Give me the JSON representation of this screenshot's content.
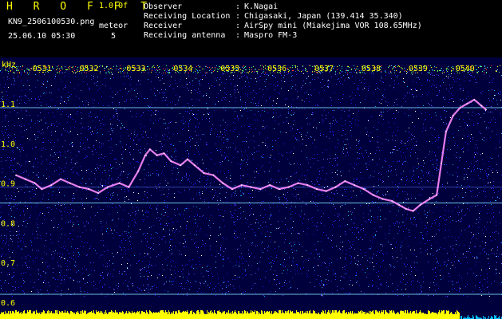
{
  "app": {
    "title": "H R O F F T",
    "version": "1.0.0f",
    "filename": "KN9_2506100530.png",
    "timestamp": "25.06.10 05:30",
    "mode_label": "meteor",
    "mode_value": "5"
  },
  "observation": [
    {
      "key": "Observer",
      "value": "K.Nagai"
    },
    {
      "key": "Receiving Location",
      "value": "Chigasaki, Japan (139.414 35.340)"
    },
    {
      "key": "Receiver",
      "value": "AirSpy mini (Miakejima VOR 108.65MHz)"
    },
    {
      "key": "Receiving antenna",
      "value": "Maspro FM-3"
    }
  ],
  "colors": {
    "background": "#00003c",
    "signal": "#ff88ff",
    "reference_line": "#7fe0ff",
    "power_bar": "#ffff00",
    "labels": "#ffff00"
  },
  "chart_data": {
    "type": "heatmap",
    "ylabel": "kHz",
    "ylim": [
      0.6,
      1.16
    ],
    "yticks": [
      "0.6",
      "0.7",
      "0.8",
      "0.9",
      "1.0",
      "1.1"
    ],
    "xticks": [
      "0531",
      "0532",
      "0533",
      "0534",
      "0535",
      "0536",
      "0537",
      "0538",
      "0539",
      "0540"
    ],
    "xlim_minutes": [
      0.0,
      10.0
    ],
    "reference_lines_khz": [
      1.09,
      0.85,
      0.62
    ],
    "trace": [
      {
        "t": 0.0,
        "f": 0.92
      },
      {
        "t": 0.2,
        "f": 0.91
      },
      {
        "t": 0.4,
        "f": 0.9
      },
      {
        "t": 0.55,
        "f": 0.885
      },
      {
        "t": 0.75,
        "f": 0.895
      },
      {
        "t": 0.95,
        "f": 0.91
      },
      {
        "t": 1.15,
        "f": 0.9
      },
      {
        "t": 1.35,
        "f": 0.89
      },
      {
        "t": 1.55,
        "f": 0.885
      },
      {
        "t": 1.75,
        "f": 0.875
      },
      {
        "t": 1.95,
        "f": 0.89
      },
      {
        "t": 2.2,
        "f": 0.9
      },
      {
        "t": 2.4,
        "f": 0.89
      },
      {
        "t": 2.6,
        "f": 0.93
      },
      {
        "t": 2.75,
        "f": 0.97
      },
      {
        "t": 2.85,
        "f": 0.985
      },
      {
        "t": 3.0,
        "f": 0.97
      },
      {
        "t": 3.15,
        "f": 0.975
      },
      {
        "t": 3.3,
        "f": 0.955
      },
      {
        "t": 3.5,
        "f": 0.945
      },
      {
        "t": 3.65,
        "f": 0.96
      },
      {
        "t": 3.8,
        "f": 0.945
      },
      {
        "t": 4.0,
        "f": 0.925
      },
      {
        "t": 4.2,
        "f": 0.92
      },
      {
        "t": 4.4,
        "f": 0.9
      },
      {
        "t": 4.6,
        "f": 0.885
      },
      {
        "t": 4.8,
        "f": 0.895
      },
      {
        "t": 5.0,
        "f": 0.89
      },
      {
        "t": 5.2,
        "f": 0.885
      },
      {
        "t": 5.4,
        "f": 0.895
      },
      {
        "t": 5.6,
        "f": 0.885
      },
      {
        "t": 5.8,
        "f": 0.89
      },
      {
        "t": 6.0,
        "f": 0.9
      },
      {
        "t": 6.2,
        "f": 0.895
      },
      {
        "t": 6.4,
        "f": 0.885
      },
      {
        "t": 6.6,
        "f": 0.88
      },
      {
        "t": 6.8,
        "f": 0.89
      },
      {
        "t": 7.0,
        "f": 0.905
      },
      {
        "t": 7.2,
        "f": 0.895
      },
      {
        "t": 7.4,
        "f": 0.885
      },
      {
        "t": 7.6,
        "f": 0.87
      },
      {
        "t": 7.8,
        "f": 0.86
      },
      {
        "t": 8.0,
        "f": 0.855
      },
      {
        "t": 8.15,
        "f": 0.845
      },
      {
        "t": 8.3,
        "f": 0.835
      },
      {
        "t": 8.45,
        "f": 0.83
      },
      {
        "t": 8.6,
        "f": 0.845
      },
      {
        "t": 8.8,
        "f": 0.86
      },
      {
        "t": 8.95,
        "f": 0.87
      },
      {
        "t": 9.05,
        "f": 0.95
      },
      {
        "t": 9.15,
        "f": 1.03
      },
      {
        "t": 9.3,
        "f": 1.07
      },
      {
        "t": 9.45,
        "f": 1.09
      },
      {
        "t": 9.6,
        "f": 1.1
      },
      {
        "t": 9.75,
        "f": 1.11
      },
      {
        "t": 9.9,
        "f": 1.095
      },
      {
        "t": 10.0,
        "f": 1.085
      }
    ]
  }
}
